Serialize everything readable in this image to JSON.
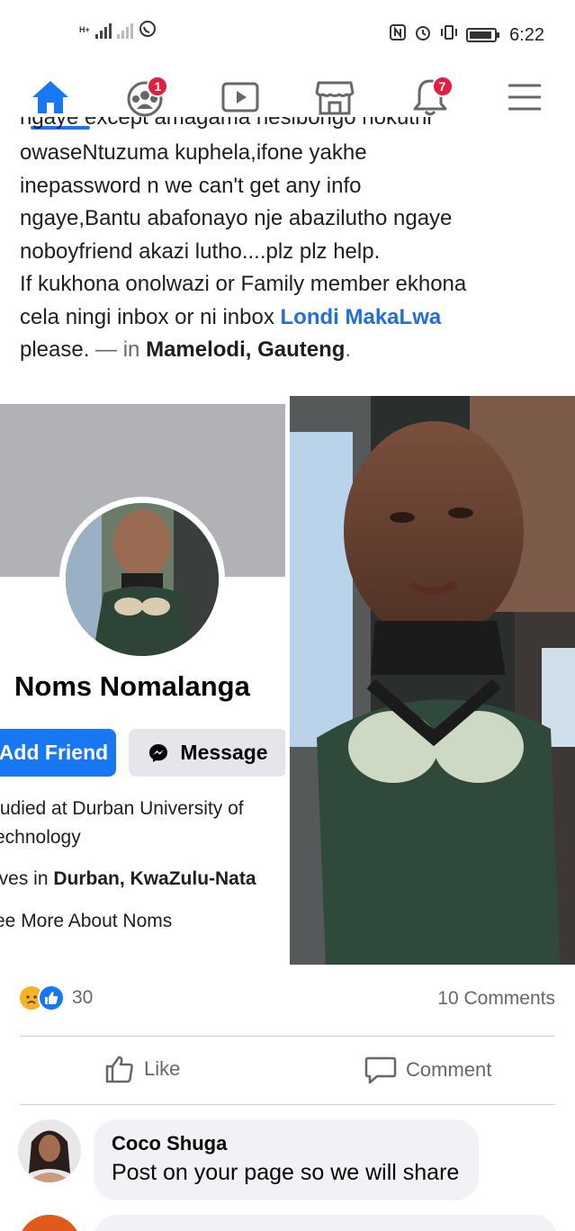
{
  "status_bar": {
    "network_label": "H+",
    "time": "6:22"
  },
  "nav": {
    "groups_badge": "1",
    "notifications_badge": "7"
  },
  "post": {
    "clipped_line": "ngaye except amagama nesibongo nokuthi",
    "line1": "owaseNtuzuma kuphela,ifone yakhe",
    "line2": "inepassword n we can't get any info",
    "line3": "ngaye,Bantu abafonayo nje abazilutho ngaye",
    "line4": "noboyfriend akazi lutho....plz plz help.",
    "line5": "If kukhona onolwazi or Family member ekhona",
    "line6_prefix": "cela ningi inbox or ni inbox ",
    "mention": "Londi MakaLwa",
    "line7_prefix": "please.",
    "location_sep": " — in ",
    "location": "Mamelodi, Gauteng",
    "period": "."
  },
  "profile_card": {
    "name": "Noms Nomalanga",
    "add_friend": "Add Friend",
    "message": "Message",
    "studied_line1": "tudied at Durban University of",
    "studied_line2": "echnology",
    "lives_prefix": "ives in ",
    "lives_place": "Durban, KwaZulu-Nata",
    "see_more": "ee More About Noms"
  },
  "reactions": {
    "count": "30",
    "comments": "10 Comments",
    "icons": [
      "sad-icon",
      "like-icon"
    ]
  },
  "actions": {
    "like": "Like",
    "comment": "Comment"
  },
  "comments": [
    {
      "name": "Coco Shuga",
      "text": "Post on your page so we will share"
    }
  ],
  "colors": {
    "brand_blue": "#1877f2",
    "badge_red": "#e41e3f",
    "link_blue": "#216fdb"
  }
}
